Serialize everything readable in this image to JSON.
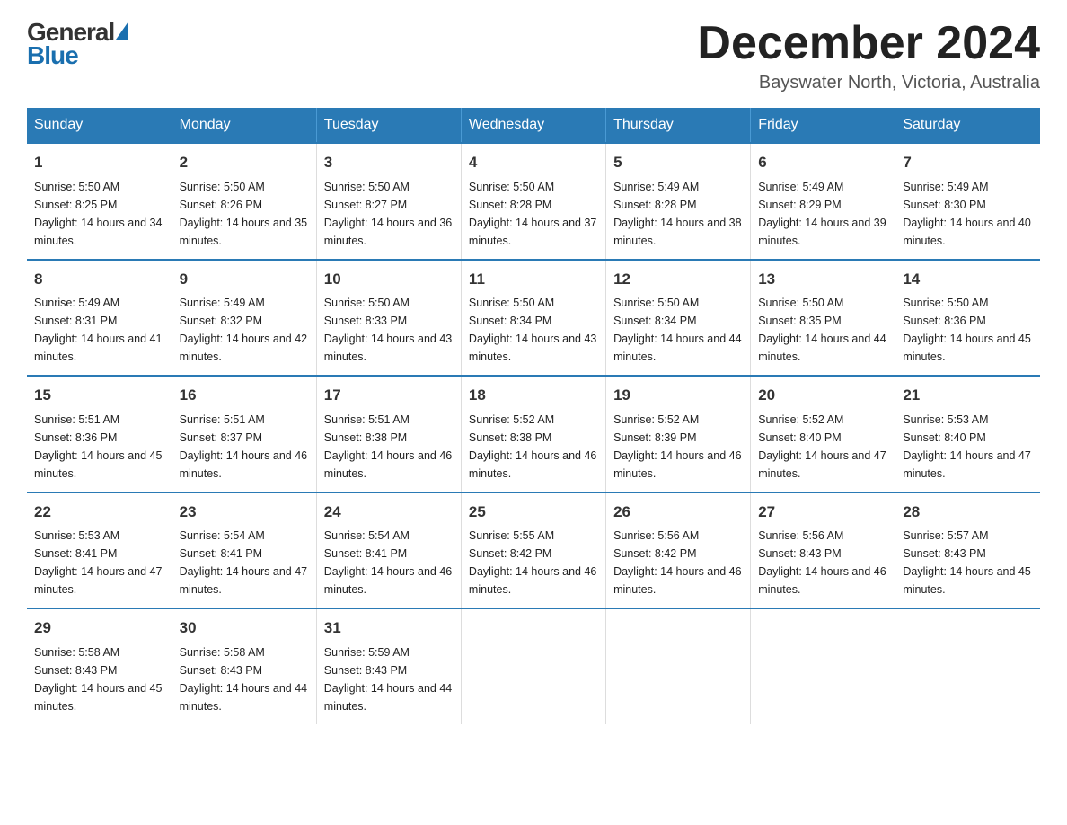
{
  "header": {
    "logo_general": "General",
    "logo_blue": "Blue",
    "month_title": "December 2024",
    "location": "Bayswater North, Victoria, Australia"
  },
  "weekdays": [
    "Sunday",
    "Monday",
    "Tuesday",
    "Wednesday",
    "Thursday",
    "Friday",
    "Saturday"
  ],
  "weeks": [
    [
      {
        "day": "1",
        "sunrise": "5:50 AM",
        "sunset": "8:25 PM",
        "daylight": "14 hours and 34 minutes."
      },
      {
        "day": "2",
        "sunrise": "5:50 AM",
        "sunset": "8:26 PM",
        "daylight": "14 hours and 35 minutes."
      },
      {
        "day": "3",
        "sunrise": "5:50 AM",
        "sunset": "8:27 PM",
        "daylight": "14 hours and 36 minutes."
      },
      {
        "day": "4",
        "sunrise": "5:50 AM",
        "sunset": "8:28 PM",
        "daylight": "14 hours and 37 minutes."
      },
      {
        "day": "5",
        "sunrise": "5:49 AM",
        "sunset": "8:28 PM",
        "daylight": "14 hours and 38 minutes."
      },
      {
        "day": "6",
        "sunrise": "5:49 AM",
        "sunset": "8:29 PM",
        "daylight": "14 hours and 39 minutes."
      },
      {
        "day": "7",
        "sunrise": "5:49 AM",
        "sunset": "8:30 PM",
        "daylight": "14 hours and 40 minutes."
      }
    ],
    [
      {
        "day": "8",
        "sunrise": "5:49 AM",
        "sunset": "8:31 PM",
        "daylight": "14 hours and 41 minutes."
      },
      {
        "day": "9",
        "sunrise": "5:49 AM",
        "sunset": "8:32 PM",
        "daylight": "14 hours and 42 minutes."
      },
      {
        "day": "10",
        "sunrise": "5:50 AM",
        "sunset": "8:33 PM",
        "daylight": "14 hours and 43 minutes."
      },
      {
        "day": "11",
        "sunrise": "5:50 AM",
        "sunset": "8:34 PM",
        "daylight": "14 hours and 43 minutes."
      },
      {
        "day": "12",
        "sunrise": "5:50 AM",
        "sunset": "8:34 PM",
        "daylight": "14 hours and 44 minutes."
      },
      {
        "day": "13",
        "sunrise": "5:50 AM",
        "sunset": "8:35 PM",
        "daylight": "14 hours and 44 minutes."
      },
      {
        "day": "14",
        "sunrise": "5:50 AM",
        "sunset": "8:36 PM",
        "daylight": "14 hours and 45 minutes."
      }
    ],
    [
      {
        "day": "15",
        "sunrise": "5:51 AM",
        "sunset": "8:36 PM",
        "daylight": "14 hours and 45 minutes."
      },
      {
        "day": "16",
        "sunrise": "5:51 AM",
        "sunset": "8:37 PM",
        "daylight": "14 hours and 46 minutes."
      },
      {
        "day": "17",
        "sunrise": "5:51 AM",
        "sunset": "8:38 PM",
        "daylight": "14 hours and 46 minutes."
      },
      {
        "day": "18",
        "sunrise": "5:52 AM",
        "sunset": "8:38 PM",
        "daylight": "14 hours and 46 minutes."
      },
      {
        "day": "19",
        "sunrise": "5:52 AM",
        "sunset": "8:39 PM",
        "daylight": "14 hours and 46 minutes."
      },
      {
        "day": "20",
        "sunrise": "5:52 AM",
        "sunset": "8:40 PM",
        "daylight": "14 hours and 47 minutes."
      },
      {
        "day": "21",
        "sunrise": "5:53 AM",
        "sunset": "8:40 PM",
        "daylight": "14 hours and 47 minutes."
      }
    ],
    [
      {
        "day": "22",
        "sunrise": "5:53 AM",
        "sunset": "8:41 PM",
        "daylight": "14 hours and 47 minutes."
      },
      {
        "day": "23",
        "sunrise": "5:54 AM",
        "sunset": "8:41 PM",
        "daylight": "14 hours and 47 minutes."
      },
      {
        "day": "24",
        "sunrise": "5:54 AM",
        "sunset": "8:41 PM",
        "daylight": "14 hours and 46 minutes."
      },
      {
        "day": "25",
        "sunrise": "5:55 AM",
        "sunset": "8:42 PM",
        "daylight": "14 hours and 46 minutes."
      },
      {
        "day": "26",
        "sunrise": "5:56 AM",
        "sunset": "8:42 PM",
        "daylight": "14 hours and 46 minutes."
      },
      {
        "day": "27",
        "sunrise": "5:56 AM",
        "sunset": "8:43 PM",
        "daylight": "14 hours and 46 minutes."
      },
      {
        "day": "28",
        "sunrise": "5:57 AM",
        "sunset": "8:43 PM",
        "daylight": "14 hours and 45 minutes."
      }
    ],
    [
      {
        "day": "29",
        "sunrise": "5:58 AM",
        "sunset": "8:43 PM",
        "daylight": "14 hours and 45 minutes."
      },
      {
        "day": "30",
        "sunrise": "5:58 AM",
        "sunset": "8:43 PM",
        "daylight": "14 hours and 44 minutes."
      },
      {
        "day": "31",
        "sunrise": "5:59 AM",
        "sunset": "8:43 PM",
        "daylight": "14 hours and 44 minutes."
      },
      null,
      null,
      null,
      null
    ]
  ]
}
